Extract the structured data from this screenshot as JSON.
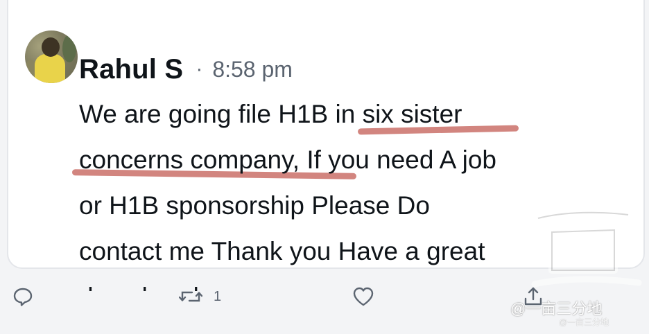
{
  "tweet": {
    "author_name": "Rahul S",
    "separator": "·",
    "time": "8:58 pm",
    "lines": [
      "We are going file H1B in six sister",
      "concerns company, If you need A job",
      "or H1B sponsorship Please Do",
      "contact me Thank you Have a great",
      "day ahead"
    ]
  },
  "actions": {
    "reply_icon": "reply-icon",
    "retweet_icon": "retweet-icon",
    "retweet_count": "1",
    "like_icon": "heart-icon",
    "share_icon": "share-icon"
  },
  "watermark": {
    "text": "@一亩三分地",
    "small_text": "@一亩三分地"
  },
  "colors": {
    "text": "#0f1419",
    "muted": "#5b6470",
    "highlight": "#c0564e"
  }
}
